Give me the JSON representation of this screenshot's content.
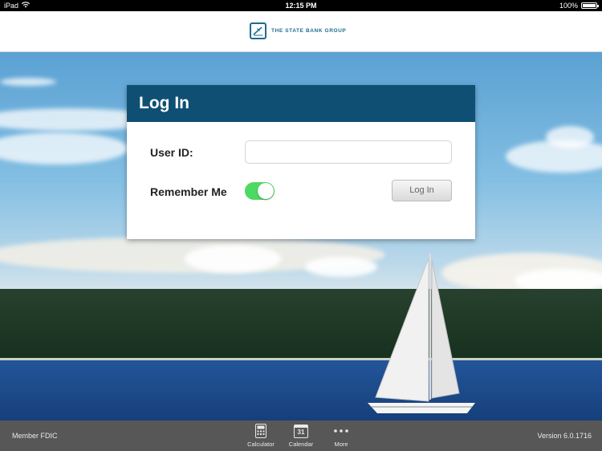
{
  "status_bar": {
    "device": "iPad",
    "time": "12:15 PM",
    "battery_text": "100%",
    "battery_level": 1.0
  },
  "header": {
    "brand_name": "THE STATE BANK GROUP"
  },
  "login": {
    "title": "Log In",
    "user_id_label": "User ID:",
    "user_id_value": "",
    "user_id_placeholder": "",
    "remember_label": "Remember Me",
    "remember_on": true,
    "login_button": "Log In"
  },
  "footer": {
    "member_text": "Member FDIC",
    "version_text": "Version 6.0.1716",
    "tabs": [
      {
        "label": "Calculator",
        "icon": "calculator-icon"
      },
      {
        "label": "Calendar",
        "icon": "calendar-icon",
        "icon_text": "31"
      },
      {
        "label": "More",
        "icon": "more-icon"
      }
    ]
  },
  "colors": {
    "card_header": "#0f4f73",
    "toggle_on": "#4cd964",
    "brand": "#1f6b8f"
  }
}
